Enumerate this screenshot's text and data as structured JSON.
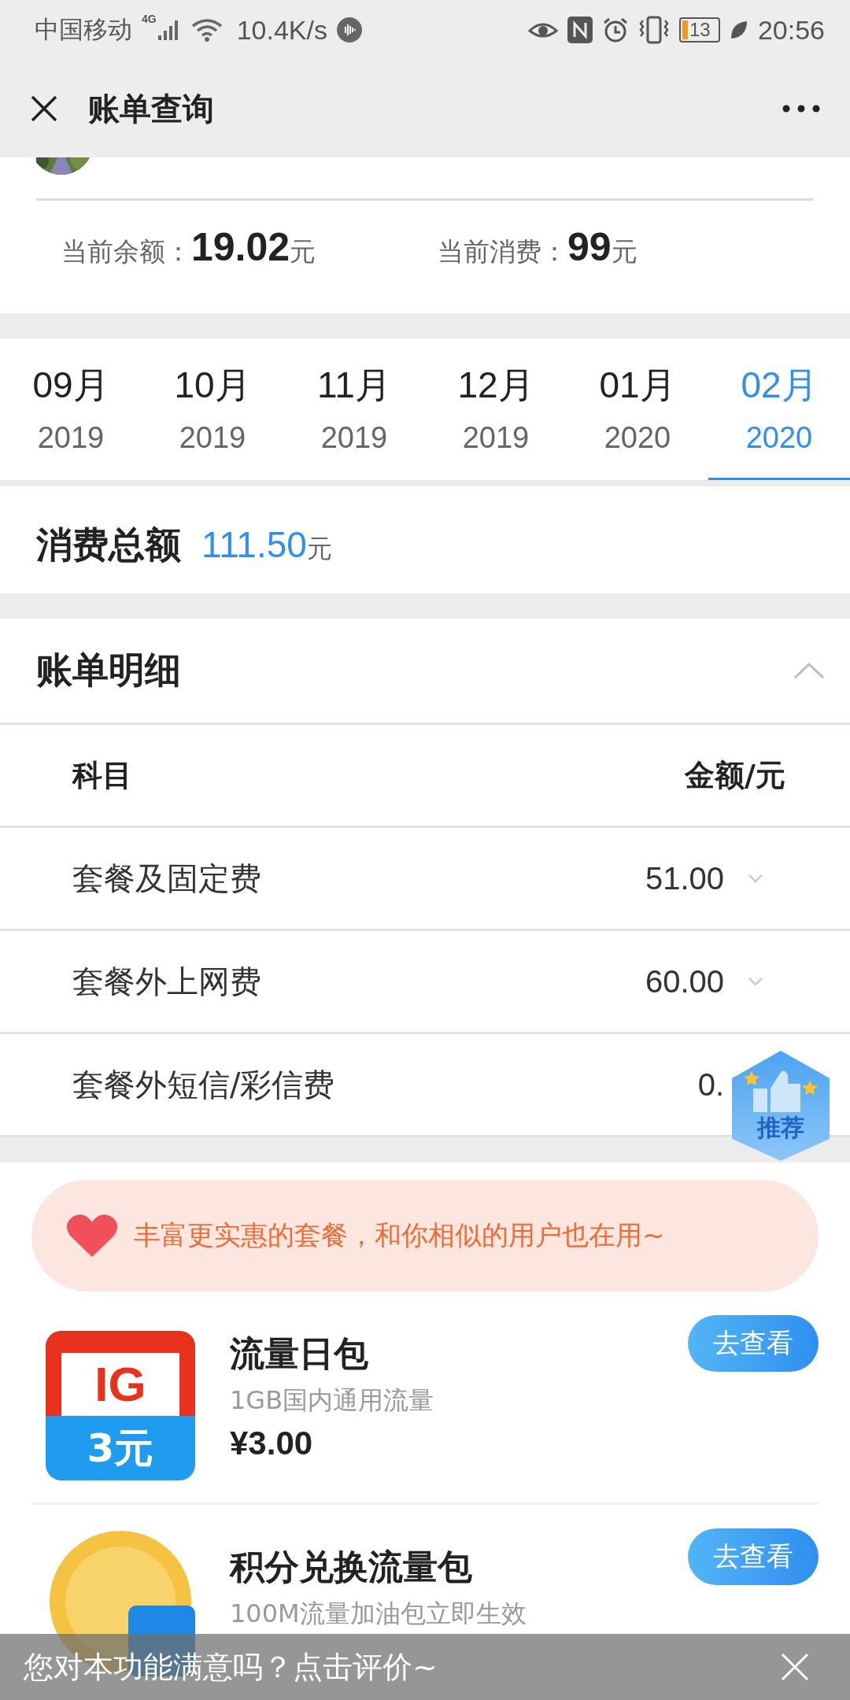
{
  "status_bar": {
    "carrier": "中国移动",
    "network": "4G",
    "speed": "10.4K/s",
    "battery": "13",
    "time": "20:56"
  },
  "header": {
    "title": "账单查询"
  },
  "summary": [
    {
      "label": "当前余额：",
      "value": "19.02",
      "unit": "元"
    },
    {
      "label": "当前消费：",
      "value": "99",
      "unit": "元"
    }
  ],
  "months": [
    {
      "month": "09月",
      "year": "2019",
      "selected": false
    },
    {
      "month": "10月",
      "year": "2019",
      "selected": false
    },
    {
      "month": "11月",
      "year": "2019",
      "selected": false
    },
    {
      "month": "12月",
      "year": "2019",
      "selected": false
    },
    {
      "month": "01月",
      "year": "2020",
      "selected": false
    },
    {
      "month": "02月",
      "year": "2020",
      "selected": true
    }
  ],
  "total": {
    "label": "消费总额",
    "value": "111.50",
    "unit": "元"
  },
  "bill_detail": {
    "title": "账单明细",
    "expanded": true,
    "columns": [
      "科目",
      "金额/元"
    ],
    "rows": [
      {
        "item": "套餐及固定费",
        "amount": "51.00"
      },
      {
        "item": "套餐外上网费",
        "amount": "60.00"
      },
      {
        "item": "套餐外短信/彩信费",
        "amount": "0."
      }
    ]
  },
  "recommend_badge": {
    "label": "推荐"
  },
  "promo": {
    "banner": "丰富更实惠的套餐，和你相似的用户也在用~",
    "products": [
      {
        "kind": "data-day",
        "icon_text": [
          "IG",
          "3元"
        ],
        "name": "流量日包",
        "description": "1GB国内通用流量",
        "price": "¥3.00",
        "button": "去查看"
      },
      {
        "kind": "points",
        "name": "积分兑换流量包",
        "description": "100M流量加油包立即生效",
        "button": "去查看"
      }
    ]
  },
  "toast": {
    "text": "您对本功能满意吗？点击评价~"
  }
}
